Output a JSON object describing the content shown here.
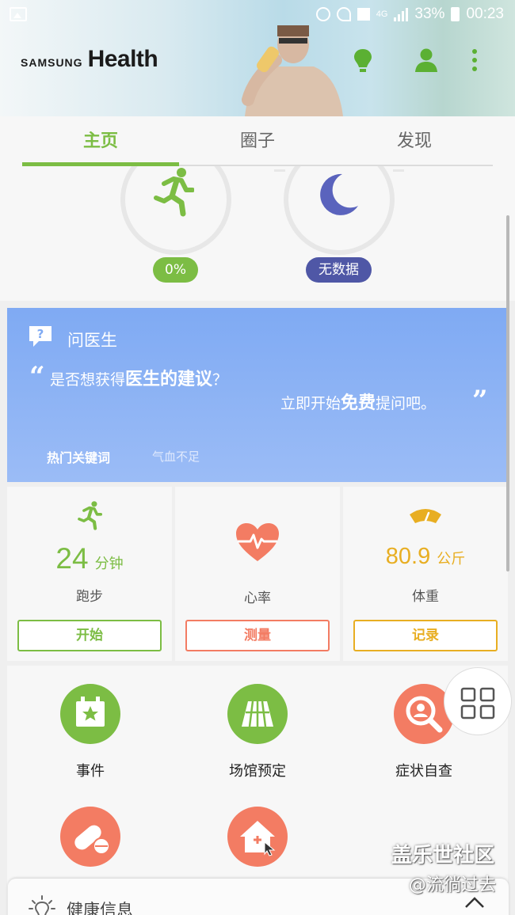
{
  "status_bar": {
    "network": "4G",
    "battery": "33%",
    "time": "00:23"
  },
  "header": {
    "brand_small": "SAMSUNG",
    "brand_large": "Health"
  },
  "tabs": [
    {
      "label": "主页"
    },
    {
      "label": "圈子"
    },
    {
      "label": "发现"
    }
  ],
  "rings": {
    "activity_pill": "0%",
    "sleep_pill": "无数据"
  },
  "ask_doctor": {
    "title": "问医生",
    "line1_a": "是否想获得",
    "line1_b": "医生的建议",
    "line1_c": "？",
    "line2_a": "立即开始",
    "line2_b": "免费",
    "line2_c": "提问吧。",
    "keywords_label": "热门关键词",
    "keyword": "气血不足"
  },
  "trackers": [
    {
      "value": "24",
      "unit": "分钟",
      "name": "跑步",
      "button": "开始"
    },
    {
      "value": "",
      "unit": "",
      "name": "心率",
      "button": "测量"
    },
    {
      "value": "80.9",
      "unit": "公斤",
      "name": "体重",
      "button": "记录"
    }
  ],
  "shortcuts": [
    {
      "label": "事件"
    },
    {
      "label": "场馆预定"
    },
    {
      "label": "症状自查"
    },
    {
      "label": ""
    },
    {
      "label": ""
    }
  ],
  "health_info": {
    "label": "健康信息"
  },
  "watermark": {
    "line1": "盖乐世社区",
    "line2": "@流徜过去"
  },
  "colors": {
    "green": "#7cbd44",
    "coral": "#f37c63",
    "amber": "#e8ae22",
    "indigo": "#4f57a6",
    "doctor_blue": "#86aef4"
  }
}
